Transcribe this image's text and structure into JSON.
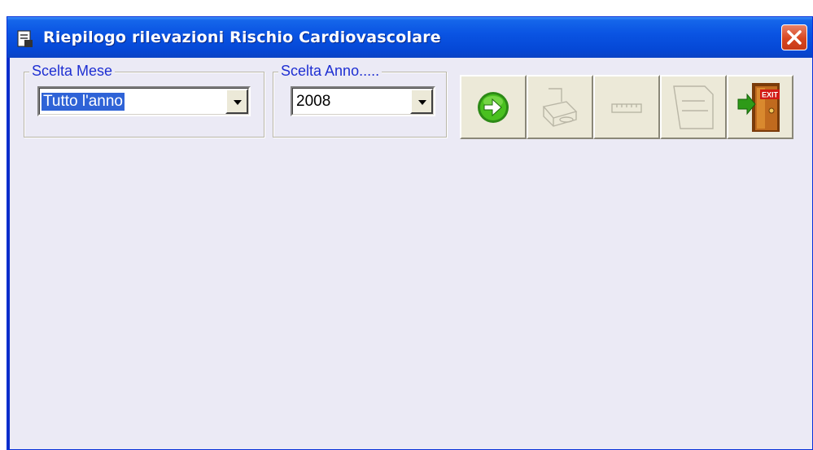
{
  "window": {
    "title": "Riepilogo rilevazioni Rischio Cardiovascolare"
  },
  "month_group": {
    "label": "Scelta Mese",
    "selected": "Tutto l'anno"
  },
  "year_group": {
    "label": "Scelta Anno.....",
    "selected": "2008"
  },
  "toolbar": {
    "buttons": [
      {
        "icon": "go-arrow-icon",
        "enabled": true
      },
      {
        "icon": "print-icon",
        "enabled": false
      },
      {
        "icon": "ruler-icon",
        "enabled": false
      },
      {
        "icon": "document-icon",
        "enabled": false
      },
      {
        "icon": "exit-door-icon",
        "enabled": true,
        "badge": "EXIT"
      }
    ]
  },
  "colors": {
    "title_bar": "#0a54e3",
    "group_label": "#1e2fd2",
    "selection": "#2f63d7",
    "close": "#d8461f"
  }
}
